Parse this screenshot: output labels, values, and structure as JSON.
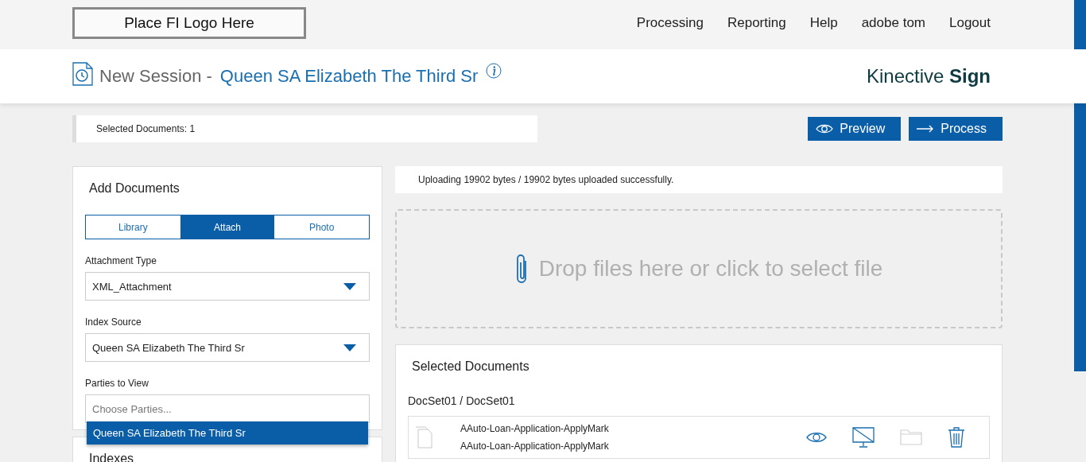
{
  "logo_placeholder": "Place FI Logo Here",
  "nav": [
    {
      "label": "Processing"
    },
    {
      "label": "Reporting"
    },
    {
      "label": "Help"
    },
    {
      "label": "adobe tom"
    },
    {
      "label": "Logout"
    }
  ],
  "header": {
    "title": "New Session -",
    "customer": "Queen SA Elizabeth The Third Sr",
    "brand": "Kinective **Sign**"
  },
  "selected_count": "Selected Documents: 1",
  "buttons": [
    {
      "kind": "preview",
      "label": "Preview"
    },
    {
      "kind": "process",
      "label": "Process"
    }
  ],
  "add_documents": {
    "title": "Add Documents",
    "tabs": [
      {
        "label": "Library",
        "selected": false
      },
      {
        "label": "Attach",
        "selected": true
      },
      {
        "label": "Photo",
        "selected": false
      }
    ],
    "attachment_type": {
      "label": "Attachment Type",
      "value": "XML_Attachment"
    },
    "index_source": {
      "label": "Index Source",
      "value": "Queen SA Elizabeth The Third Sr"
    },
    "parties": {
      "label": "Parties to View",
      "placeholder": "Choose Parties...",
      "options": [
        "Queen SA Elizabeth The Third Sr"
      ]
    }
  },
  "indexes_title": "Indexes",
  "upload_message": "Uploading 19902 bytes / 19902 bytes uploaded successfully.",
  "dropzone": "Drop files here or click to select file",
  "selected_documents": {
    "title": "Selected Documents",
    "docset": "DocSet01 / DocSet01",
    "documents": [
      {
        "names": [
          "AAuto-Loan-Application-ApplyMark",
          "AAuto-Loan-Application-ApplyMark"
        ],
        "actions": [
          {
            "kind": "view",
            "disabled": false
          },
          {
            "kind": "screen",
            "disabled": false
          },
          {
            "kind": "folder",
            "disabled": true
          },
          {
            "kind": "delete",
            "disabled": false
          }
        ]
      }
    ]
  }
}
